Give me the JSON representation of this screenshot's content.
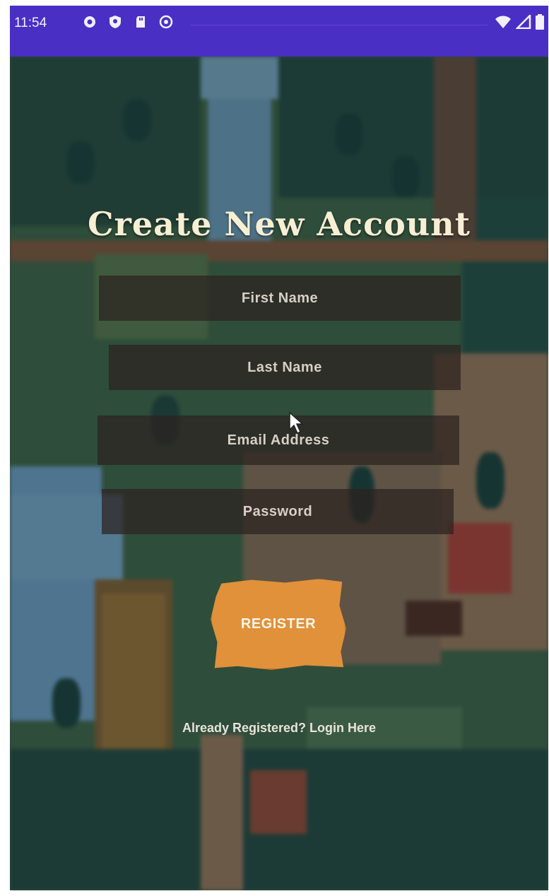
{
  "status_bar": {
    "time": "11:54",
    "left_icons": [
      "gear-icon",
      "shield-icon",
      "sd-card-icon",
      "circle-badge-icon"
    ],
    "right_icons": [
      "wifi-icon",
      "signal-icon",
      "battery-icon"
    ],
    "color": "#4a2fc4"
  },
  "screen": {
    "title": "Create New Account",
    "fields": [
      {
        "name": "first-name",
        "placeholder": "First Name"
      },
      {
        "name": "last-name",
        "placeholder": "Last Name"
      },
      {
        "name": "email-address",
        "placeholder": "Email Address"
      },
      {
        "name": "password",
        "placeholder": "Password"
      }
    ],
    "register_label": "REGISTER",
    "login_link": "Already Registered? Login Here"
  },
  "colors": {
    "title": "#f7efd4",
    "field_bg": "#2d2320",
    "button": "#e0913a",
    "background": "#2c4a3a"
  }
}
